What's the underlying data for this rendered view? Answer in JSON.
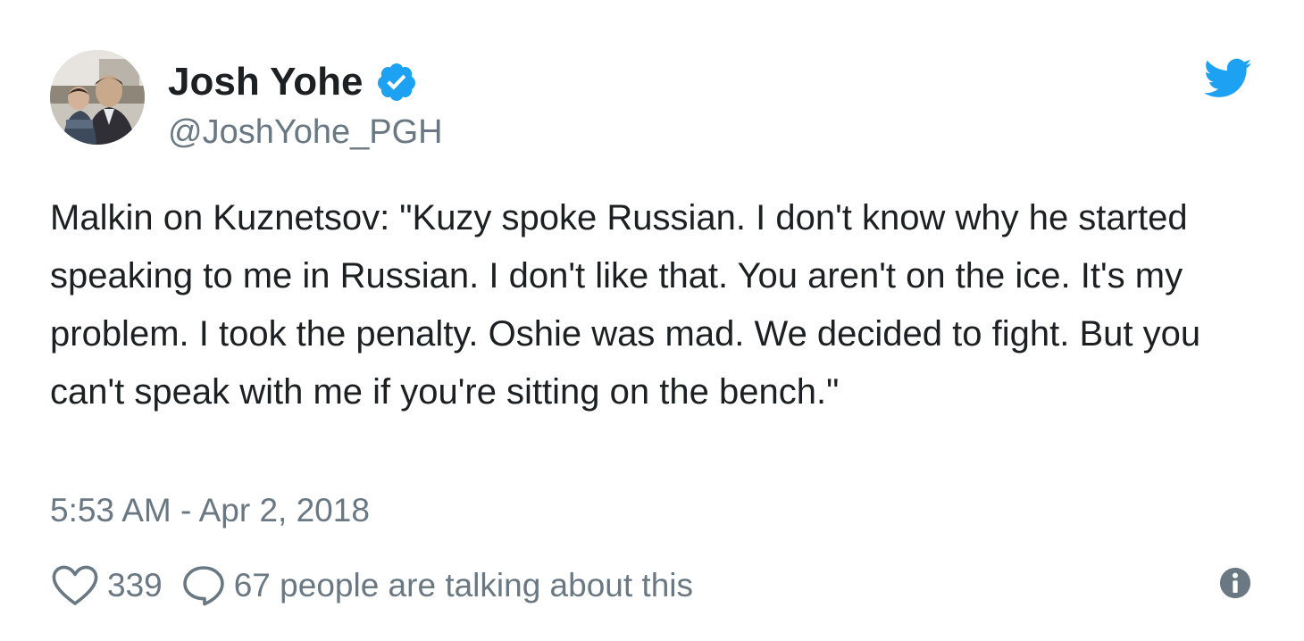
{
  "author": {
    "name": "Josh Yohe",
    "handle": "@JoshYohe_PGH",
    "verified": true
  },
  "tweet": {
    "text": "Malkin on Kuznetsov: \"Kuzy spoke Russian. I don't know why he started speaking to me in Russian. I don't like that. You aren't on the ice. It's my problem. I took the penalty. Oshie was mad. We decided to fight. But you can't speak with me if you're sitting on the bench.\"",
    "timestamp": "5:53 AM - Apr 2, 2018"
  },
  "actions": {
    "likes": "339",
    "conversation": "67 people are talking about this"
  },
  "icons": {
    "verified": "verified-badge-icon",
    "brand": "twitter-bird-icon",
    "like": "heart-icon",
    "reply": "speech-bubble-icon",
    "info": "info-icon"
  },
  "colors": {
    "brand_blue": "#1da1f2",
    "text": "#1c2022",
    "secondary_text": "#697882"
  }
}
